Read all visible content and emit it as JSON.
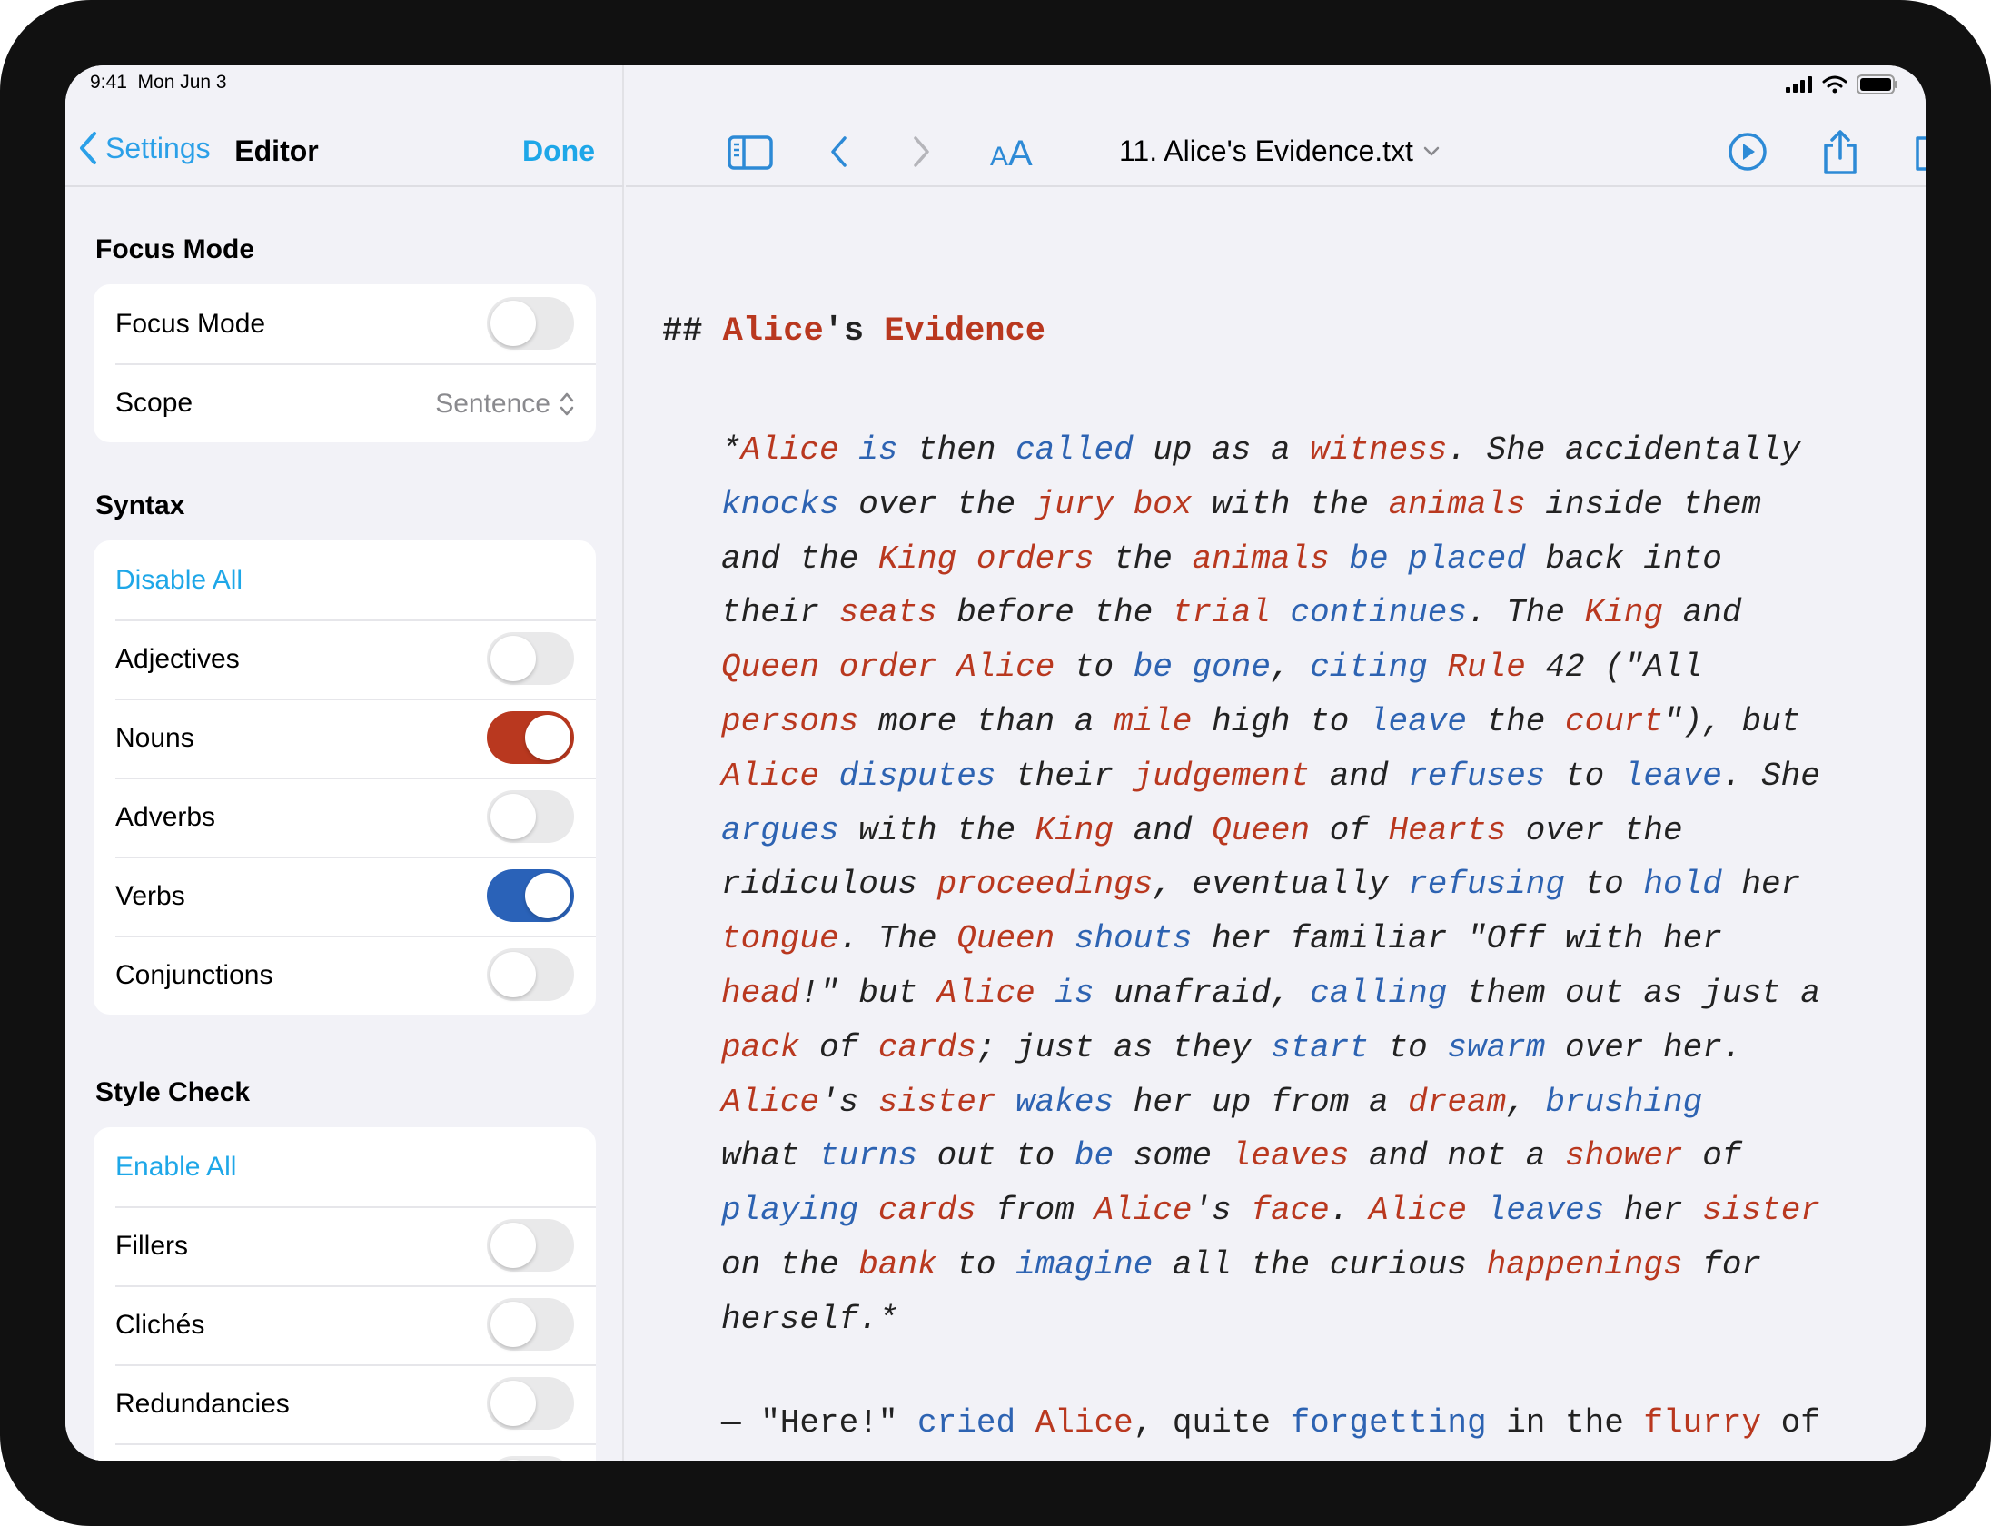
{
  "status_bar": {
    "time": "9:41",
    "date": "Mon Jun 3"
  },
  "sidebar": {
    "back_label": "Settings",
    "title": "Editor",
    "done_label": "Done",
    "focus_section": {
      "title": "Focus Mode",
      "rows": [
        {
          "label": "Focus Mode",
          "on": false
        },
        {
          "label": "Scope",
          "value": "Sentence"
        }
      ]
    },
    "syntax_section": {
      "title": "Syntax",
      "action": "Disable All",
      "toggles": [
        {
          "label": "Adjectives",
          "on": false
        },
        {
          "label": "Nouns",
          "on": true,
          "color": "#b9381f"
        },
        {
          "label": "Adverbs",
          "on": false
        },
        {
          "label": "Verbs",
          "on": true,
          "color": "#2a62b8"
        },
        {
          "label": "Conjunctions",
          "on": false
        }
      ]
    },
    "style_section": {
      "title": "Style Check",
      "action": "Enable All",
      "toggles": [
        {
          "label": "Fillers",
          "on": false
        },
        {
          "label": "Clichés",
          "on": false
        },
        {
          "label": "Redundancies",
          "on": false
        }
      ]
    }
  },
  "toolbar": {
    "document_title": "11. Alice's Evidence.txt",
    "icons": [
      "sidebar-icon",
      "chevron-left-icon",
      "chevron-right-icon",
      "font-size-icon",
      "play-icon",
      "share-icon",
      "compose-icon"
    ]
  },
  "editor": {
    "heading": [
      {
        "t": "## ",
        "c": ""
      },
      {
        "t": "Alice",
        "c": "n"
      },
      {
        "t": "'s ",
        "c": ""
      },
      {
        "t": "Evidence",
        "c": "n"
      }
    ],
    "paragraph_lines": [
      [
        [
          "*",
          ""
        ],
        [
          "Alice",
          "n"
        ],
        [
          " ",
          ""
        ],
        [
          "is",
          "v"
        ],
        [
          " then ",
          ""
        ],
        [
          "called",
          "v"
        ],
        [
          " up as a ",
          ""
        ],
        [
          "witness",
          "n"
        ],
        [
          ". She accidentally",
          ""
        ]
      ],
      [
        [
          "knocks",
          "v"
        ],
        [
          " over the ",
          ""
        ],
        [
          "jury",
          "n"
        ],
        [
          " ",
          ""
        ],
        [
          "box",
          "n"
        ],
        [
          " with the ",
          ""
        ],
        [
          "animals",
          "n"
        ],
        [
          " inside them",
          ""
        ]
      ],
      [
        [
          "and the ",
          ""
        ],
        [
          "King",
          "n"
        ],
        [
          " ",
          ""
        ],
        [
          "orders",
          "n"
        ],
        [
          " the ",
          ""
        ],
        [
          "animals",
          "n"
        ],
        [
          " ",
          ""
        ],
        [
          "be",
          "v"
        ],
        [
          " ",
          ""
        ],
        [
          "placed",
          "v"
        ],
        [
          " back into",
          ""
        ]
      ],
      [
        [
          "their ",
          ""
        ],
        [
          "seats",
          "n"
        ],
        [
          " before the ",
          ""
        ],
        [
          "trial",
          "n"
        ],
        [
          " ",
          ""
        ],
        [
          "continues",
          "v"
        ],
        [
          ". The ",
          ""
        ],
        [
          "King",
          "n"
        ],
        [
          " and",
          ""
        ]
      ],
      [
        [
          "Queen",
          "n"
        ],
        [
          " ",
          ""
        ],
        [
          "order",
          "n"
        ],
        [
          " ",
          ""
        ],
        [
          "Alice",
          "n"
        ],
        [
          " to ",
          ""
        ],
        [
          "be",
          "v"
        ],
        [
          " ",
          ""
        ],
        [
          "gone",
          "v"
        ],
        [
          ", ",
          ""
        ],
        [
          "citing",
          "v"
        ],
        [
          " ",
          ""
        ],
        [
          "Rule",
          "n"
        ],
        [
          " 42 (\"All",
          ""
        ]
      ],
      [
        [
          "persons",
          "n"
        ],
        [
          " more than a ",
          ""
        ],
        [
          "mile",
          "n"
        ],
        [
          " high to ",
          ""
        ],
        [
          "leave",
          "v"
        ],
        [
          " the ",
          ""
        ],
        [
          "court",
          "n"
        ],
        [
          "\"), but",
          ""
        ]
      ],
      [
        [
          "Alice",
          "n"
        ],
        [
          " ",
          ""
        ],
        [
          "disputes",
          "v"
        ],
        [
          " their ",
          ""
        ],
        [
          "judgement",
          "n"
        ],
        [
          " and ",
          ""
        ],
        [
          "refuses",
          "v"
        ],
        [
          " to ",
          ""
        ],
        [
          "leave",
          "v"
        ],
        [
          ". She",
          ""
        ]
      ],
      [
        [
          "argues",
          "v"
        ],
        [
          " with the ",
          ""
        ],
        [
          "King",
          "n"
        ],
        [
          " and ",
          ""
        ],
        [
          "Queen",
          "n"
        ],
        [
          " of ",
          ""
        ],
        [
          "Hearts",
          "n"
        ],
        [
          " over the",
          ""
        ]
      ],
      [
        [
          "ridiculous ",
          ""
        ],
        [
          "proceedings",
          "n"
        ],
        [
          ", eventually ",
          ""
        ],
        [
          "refusing",
          "v"
        ],
        [
          " to ",
          ""
        ],
        [
          "hold",
          "v"
        ],
        [
          " her",
          ""
        ]
      ],
      [
        [
          "tongue",
          "n"
        ],
        [
          ". The ",
          ""
        ],
        [
          "Queen",
          "n"
        ],
        [
          " ",
          ""
        ],
        [
          "shouts",
          "v"
        ],
        [
          " her familiar \"Off with her",
          ""
        ]
      ],
      [
        [
          "head",
          "n"
        ],
        [
          "!\" but ",
          ""
        ],
        [
          "Alice",
          "n"
        ],
        [
          " ",
          ""
        ],
        [
          "is",
          "v"
        ],
        [
          " unafraid, ",
          ""
        ],
        [
          "calling",
          "v"
        ],
        [
          " them out as just a",
          ""
        ]
      ],
      [
        [
          "pack",
          "n"
        ],
        [
          " of ",
          ""
        ],
        [
          "cards",
          "n"
        ],
        [
          "; just as they ",
          ""
        ],
        [
          "start",
          "v"
        ],
        [
          " to ",
          ""
        ],
        [
          "swarm",
          "v"
        ],
        [
          " over her.",
          ""
        ]
      ],
      [
        [
          "Alice",
          "n"
        ],
        [
          "'s ",
          ""
        ],
        [
          "sister",
          "n"
        ],
        [
          " ",
          ""
        ],
        [
          "wakes",
          "v"
        ],
        [
          " her up from a ",
          ""
        ],
        [
          "dream",
          "n"
        ],
        [
          ", ",
          ""
        ],
        [
          "brushing",
          "v"
        ]
      ],
      [
        [
          "what ",
          ""
        ],
        [
          "turns",
          "v"
        ],
        [
          " out to ",
          ""
        ],
        [
          "be",
          "v"
        ],
        [
          " some ",
          ""
        ],
        [
          "leaves",
          "n"
        ],
        [
          " and not a ",
          ""
        ],
        [
          "shower",
          "n"
        ],
        [
          " of",
          ""
        ]
      ],
      [
        [
          "playing",
          "v"
        ],
        [
          " ",
          ""
        ],
        [
          "cards",
          "n"
        ],
        [
          " from ",
          ""
        ],
        [
          "Alice",
          "n"
        ],
        [
          "'s ",
          ""
        ],
        [
          "face",
          "n"
        ],
        [
          ". ",
          ""
        ],
        [
          "Alice",
          "n"
        ],
        [
          " ",
          ""
        ],
        [
          "leaves",
          "v"
        ],
        [
          " her ",
          ""
        ],
        [
          "sister",
          "n"
        ]
      ],
      [
        [
          "on the ",
          ""
        ],
        [
          "bank",
          "n"
        ],
        [
          " to ",
          ""
        ],
        [
          "imagine",
          "v"
        ],
        [
          " all the curious ",
          ""
        ],
        [
          "happenings",
          "n"
        ],
        [
          " for",
          ""
        ]
      ],
      [
        [
          "herself.*",
          ""
        ]
      ]
    ],
    "last_line": [
      [
        "— \"Here!\" ",
        ""
      ],
      [
        "cried",
        "v"
      ],
      [
        " ",
        ""
      ],
      [
        "Alice",
        "n"
      ],
      [
        ", quite ",
        ""
      ],
      [
        "forgetting",
        "v"
      ],
      [
        " in the ",
        ""
      ],
      [
        "flurry",
        "n"
      ],
      [
        " of",
        ""
      ]
    ]
  }
}
